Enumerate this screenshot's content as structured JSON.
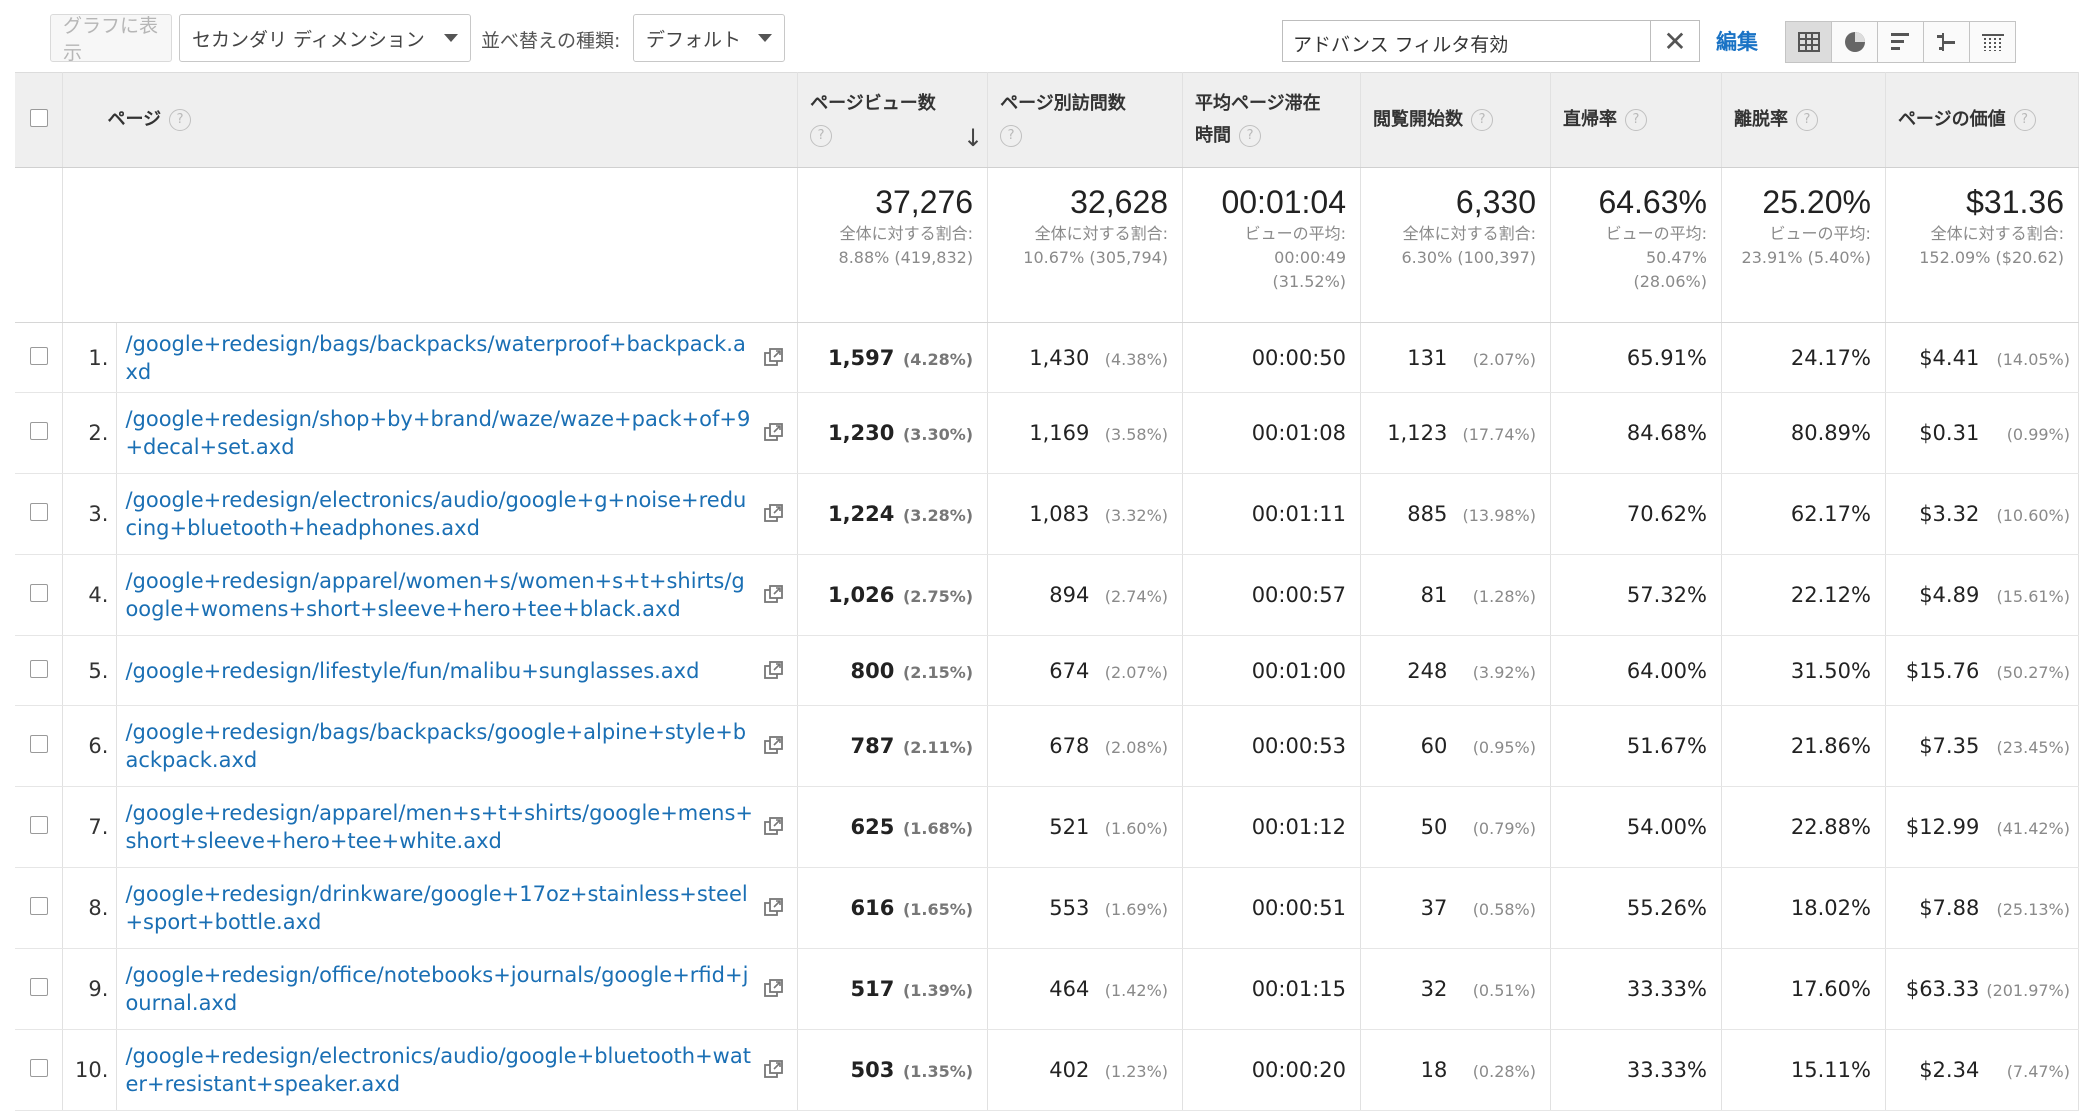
{
  "toolbar": {
    "chart_button": "グラフに表示",
    "secondary_dimension": "セカンダリ ディメンション",
    "sort_label": "並べ替えの種類:",
    "sort_value": "デフォルト",
    "filter_value": "アドバンス フィルタ有効",
    "edit_link": "編集",
    "views": [
      "table-icon",
      "pie-icon",
      "bar-icon",
      "comparison-icon",
      "pivot-icon"
    ],
    "active_view": "table-icon"
  },
  "headers": {
    "page": "ページ",
    "pageviews": "ページビュー数",
    "unique": "ページ別訪問数",
    "avg_time_1": "平均ページ滞在",
    "avg_time_2": "時間",
    "entrances": "閲覧開始数",
    "bounce": "直帰率",
    "exit": "離脱率",
    "value": "ページの価値"
  },
  "summary": {
    "pageviews": {
      "big": "37,276",
      "label": "全体に対する割合:",
      "sub": "8.88% (419,832)"
    },
    "unique": {
      "big": "32,628",
      "label": "全体に対する割合:",
      "sub": "10.67% (305,794)"
    },
    "avg_time": {
      "big": "00:01:04",
      "label": "ビューの平均:",
      "sub": "00:00:49",
      "sub2": "(31.52%)"
    },
    "entrances": {
      "big": "6,330",
      "label": "全体に対する割合:",
      "sub": "6.30% (100,397)"
    },
    "bounce": {
      "big": "64.63%",
      "label": "ビューの平均:",
      "sub": "50.47%",
      "sub2": "(28.06%)"
    },
    "exit": {
      "big": "25.20%",
      "label": "ビューの平均:",
      "sub": "23.91% (5.40%)"
    },
    "value": {
      "big": "$31.36",
      "label": "全体に対する割合:",
      "sub": "152.09% ($20.62)"
    }
  },
  "rows": [
    {
      "rank": "1.",
      "page": "/google+redesign/bags/backpacks/waterproof+backpack.axd",
      "pv": "1,597",
      "pv_pct": "(4.28%)",
      "uv": "1,430",
      "uv_pct": "(4.38%)",
      "time": "00:00:50",
      "ent": "131",
      "ent_pct": "(2.07%)",
      "bounce": "65.91%",
      "exit": "24.17%",
      "val": "$4.41",
      "val_pct": "(14.05%)"
    },
    {
      "rank": "2.",
      "page": "/google+redesign/shop+by+brand/waze/waze+pack+of+9+decal+set.axd",
      "pv": "1,230",
      "pv_pct": "(3.30%)",
      "uv": "1,169",
      "uv_pct": "(3.58%)",
      "time": "00:01:08",
      "ent": "1,123",
      "ent_pct": "(17.74%)",
      "bounce": "84.68%",
      "exit": "80.89%",
      "val": "$0.31",
      "val_pct": "(0.99%)"
    },
    {
      "rank": "3.",
      "page": "/google+redesign/electronics/audio/google+g+noise+reducing+bluetooth+headphones.axd",
      "pv": "1,224",
      "pv_pct": "(3.28%)",
      "uv": "1,083",
      "uv_pct": "(3.32%)",
      "time": "00:01:11",
      "ent": "885",
      "ent_pct": "(13.98%)",
      "bounce": "70.62%",
      "exit": "62.17%",
      "val": "$3.32",
      "val_pct": "(10.60%)"
    },
    {
      "rank": "4.",
      "page": "/google+redesign/apparel/women+s/women+s+t+shirts/google+womens+short+sleeve+hero+tee+black.axd",
      "pv": "1,026",
      "pv_pct": "(2.75%)",
      "uv": "894",
      "uv_pct": "(2.74%)",
      "time": "00:00:57",
      "ent": "81",
      "ent_pct": "(1.28%)",
      "bounce": "57.32%",
      "exit": "22.12%",
      "val": "$4.89",
      "val_pct": "(15.61%)"
    },
    {
      "rank": "5.",
      "page": "/google+redesign/lifestyle/fun/malibu+sunglasses.axd",
      "pv": "800",
      "pv_pct": "(2.15%)",
      "uv": "674",
      "uv_pct": "(2.07%)",
      "time": "00:01:00",
      "ent": "248",
      "ent_pct": "(3.92%)",
      "bounce": "64.00%",
      "exit": "31.50%",
      "val": "$15.76",
      "val_pct": "(50.27%)"
    },
    {
      "rank": "6.",
      "page": "/google+redesign/bags/backpacks/google+alpine+style+backpack.axd",
      "pv": "787",
      "pv_pct": "(2.11%)",
      "uv": "678",
      "uv_pct": "(2.08%)",
      "time": "00:00:53",
      "ent": "60",
      "ent_pct": "(0.95%)",
      "bounce": "51.67%",
      "exit": "21.86%",
      "val": "$7.35",
      "val_pct": "(23.45%)"
    },
    {
      "rank": "7.",
      "page": "/google+redesign/apparel/men+s+t+shirts/google+mens+short+sleeve+hero+tee+white.axd",
      "pv": "625",
      "pv_pct": "(1.68%)",
      "uv": "521",
      "uv_pct": "(1.60%)",
      "time": "00:01:12",
      "ent": "50",
      "ent_pct": "(0.79%)",
      "bounce": "54.00%",
      "exit": "22.88%",
      "val": "$12.99",
      "val_pct": "(41.42%)"
    },
    {
      "rank": "8.",
      "page": "/google+redesign/drinkware/google+17oz+stainless+steel+sport+bottle.axd",
      "pv": "616",
      "pv_pct": "(1.65%)",
      "uv": "553",
      "uv_pct": "(1.69%)",
      "time": "00:00:51",
      "ent": "37",
      "ent_pct": "(0.58%)",
      "bounce": "55.26%",
      "exit": "18.02%",
      "val": "$7.88",
      "val_pct": "(25.13%)"
    },
    {
      "rank": "9.",
      "page": "/google+redesign/office/notebooks+journals/google+rfid+journal.axd",
      "pv": "517",
      "pv_pct": "(1.39%)",
      "uv": "464",
      "uv_pct": "(1.42%)",
      "time": "00:01:15",
      "ent": "32",
      "ent_pct": "(0.51%)",
      "bounce": "33.33%",
      "exit": "17.60%",
      "val": "$63.33",
      "val_pct": "(201.97%)"
    },
    {
      "rank": "10.",
      "page": "/google+redesign/electronics/audio/google+bluetooth+water+resistant+speaker.axd",
      "pv": "503",
      "pv_pct": "(1.35%)",
      "uv": "402",
      "uv_pct": "(1.23%)",
      "time": "00:00:20",
      "ent": "18",
      "ent_pct": "(0.28%)",
      "bounce": "33.33%",
      "exit": "15.11%",
      "val": "$2.34",
      "val_pct": "(7.47%)"
    }
  ]
}
